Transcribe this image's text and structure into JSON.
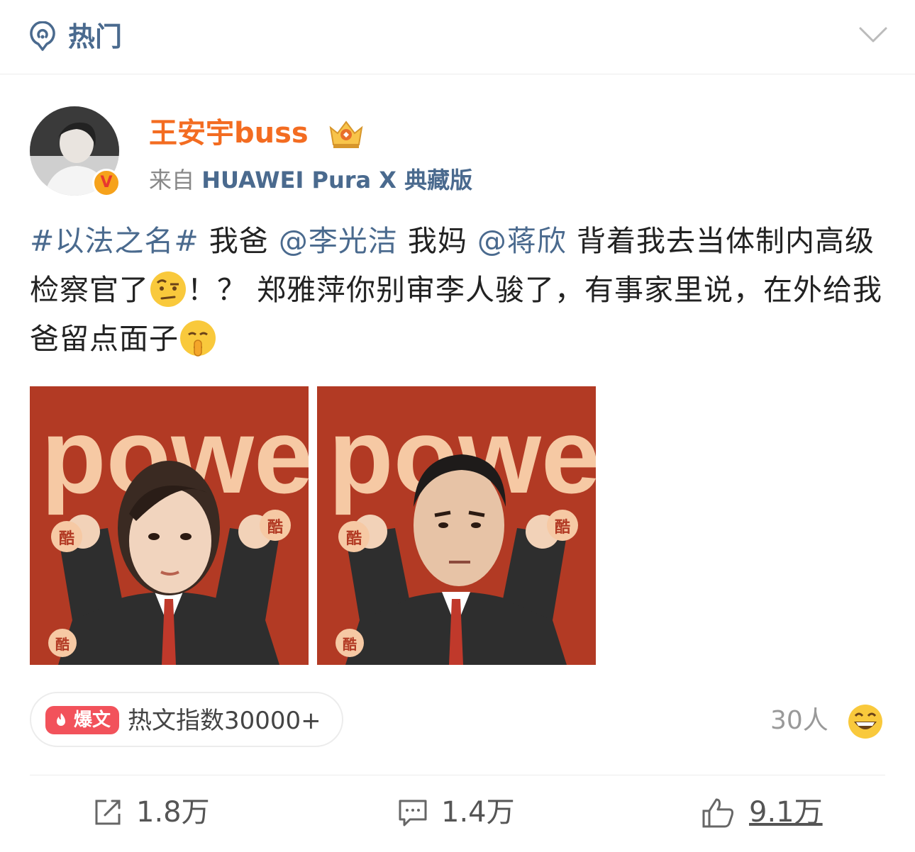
{
  "header": {
    "title": "热门",
    "icon": "hot-broadcast-icon",
    "collapse_icon": "chevron-down-icon"
  },
  "post": {
    "username": "王安宇buss",
    "badge_icon": "crown-badge-icon",
    "verified_icon": "v-verified-icon",
    "source_prefix": "来自",
    "source_device": "HUAWEI Pura X 典藏版",
    "content": {
      "topic": "#以法之名#",
      "t1": "我爸",
      "mention1": "@李光洁",
      "t2": "我妈",
      "mention2": "@蒋欣",
      "t3": "背着我去当体制内高级检察官了",
      "emoji1": "raised-eyebrow-emoji",
      "t4": "！？ 郑雅萍你别审李人骏了，有事家里说，在外给我爸留点面子",
      "emoji2": "shushing-face-emoji"
    },
    "images": [
      {
        "name": "power-sticker-woman",
        "word": "power",
        "badge": "酷"
      },
      {
        "name": "power-sticker-man",
        "word": "power",
        "badge": "酷"
      }
    ],
    "hot": {
      "tag": "爆文",
      "text": "热文指数30000+"
    },
    "reactions": {
      "count": "30人",
      "emoji": "grinning-face-emoji"
    },
    "actions": {
      "repost": "1.8万",
      "comment": "1.4万",
      "like": "9.1万"
    }
  },
  "colors": {
    "link": "#4a6a8e",
    "username": "#f36c21",
    "baowen": "#f2525b",
    "image_bg": "#b23a24",
    "power_text": "#f6c9a4"
  }
}
